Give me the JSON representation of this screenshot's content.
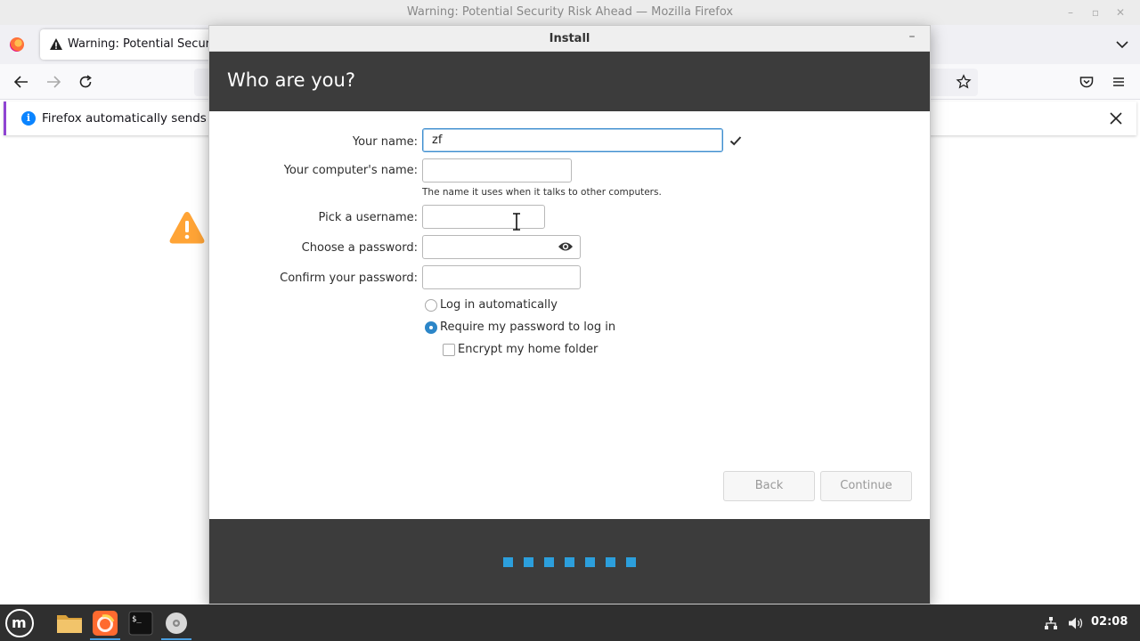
{
  "firefox": {
    "window_title": "Warning: Potential Security Risk Ahead — Mozilla Firefox",
    "tab_label": "Warning: Potential Securit",
    "notification_text": "Firefox automatically sends som"
  },
  "installer": {
    "window_title": "Install",
    "heading": "Who are you?",
    "form": {
      "name_label": "Your name:",
      "name_value": "zf",
      "computer_name_label": "Your computer's name:",
      "computer_name_value": "",
      "computer_name_hint": "The name it uses when it talks to other computers.",
      "username_label": "Pick a username:",
      "username_value": "",
      "password_label": "Choose a password:",
      "password_value": "",
      "confirm_label": "Confirm your password:",
      "confirm_value": ""
    },
    "options": {
      "auto_login_label": "Log in automatically",
      "auto_login_selected": false,
      "require_password_label": "Require my password to log in",
      "require_password_selected": true,
      "encrypt_home_label": "Encrypt my home folder",
      "encrypt_home_checked": false
    },
    "buttons": {
      "back_label": "Back",
      "continue_label": "Continue"
    },
    "progress": {
      "total_steps": 7
    }
  },
  "taskbar": {
    "clock": "02:08",
    "apps": [
      "menu",
      "files",
      "firefox",
      "terminal",
      "installer"
    ]
  },
  "colors": {
    "header_bg": "#3c3c3c",
    "accent": "#2c86c8",
    "progress_dot": "#2c9fdc",
    "taskbar_bg": "#2f2f2f"
  }
}
